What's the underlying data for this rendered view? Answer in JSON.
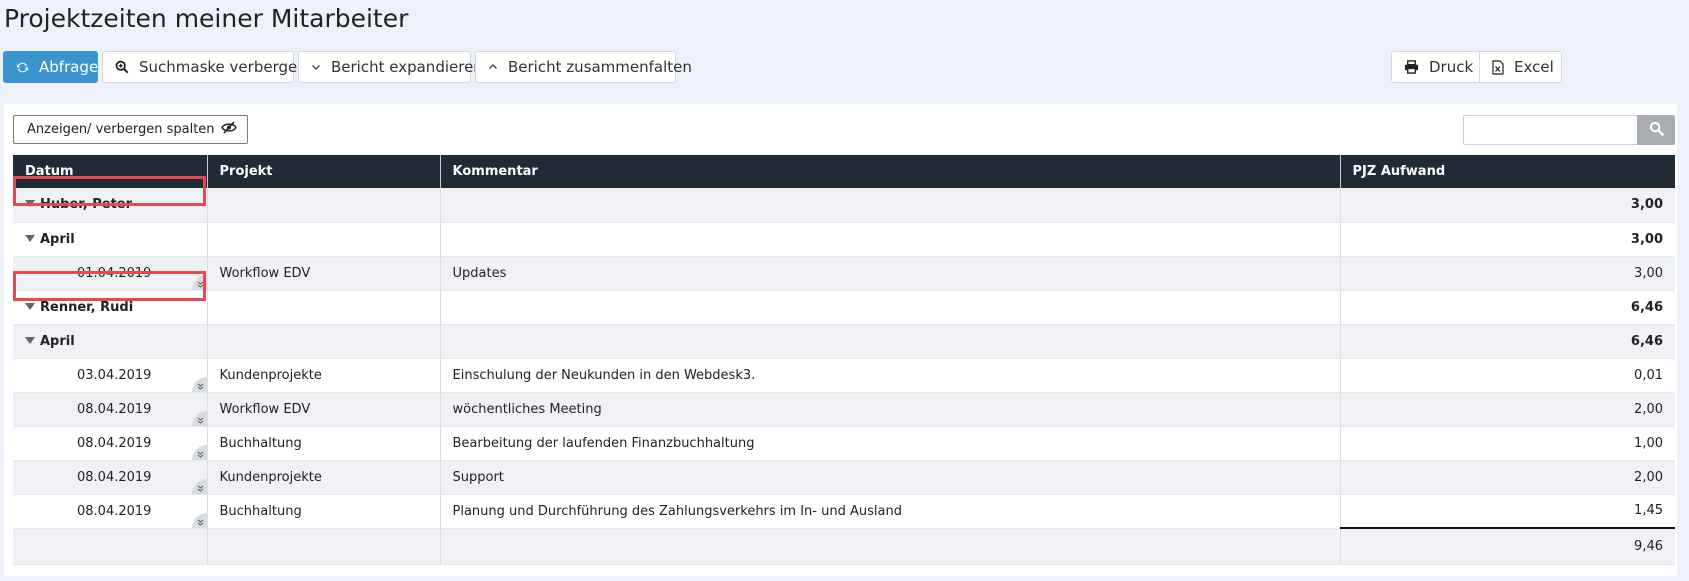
{
  "page": {
    "title": "Projektzeiten meiner Mitarbeiter"
  },
  "toolbar": {
    "query_label": "Abfrage",
    "hide_search_label": "Suchmaske verbergen",
    "expand_label": "Bericht expandieren",
    "collapse_label": "Bericht zusammenfalten",
    "print_label": "Druck",
    "excel_label": "Excel"
  },
  "panel": {
    "columns_toggle_label": "Anzeigen/ verbergen spalten",
    "search_placeholder": ""
  },
  "table": {
    "headers": [
      "Datum",
      "Projekt",
      "Kommentar",
      "PJZ Aufwand"
    ],
    "groups": [
      {
        "employee": "Huber, Peter",
        "total": "3,00",
        "months": [
          {
            "month": "April",
            "total": "3,00",
            "rows": [
              {
                "date": "01.04.2019",
                "project": "Workflow EDV",
                "comment": "Updates",
                "effort": "3,00"
              }
            ]
          }
        ]
      },
      {
        "employee": "Renner, Rudi",
        "total": "6,46",
        "months": [
          {
            "month": "April",
            "total": "6,46",
            "rows": [
              {
                "date": "03.04.2019",
                "project": "Kundenprojekte",
                "comment": "Einschulung der Neukunden in den Webdesk3.",
                "effort": "0,01"
              },
              {
                "date": "08.04.2019",
                "project": "Workflow EDV",
                "comment": "wöchentliches Meeting",
                "effort": "2,00"
              },
              {
                "date": "08.04.2019",
                "project": "Buchhaltung",
                "comment": "Bearbeitung der laufenden Finanzbuchhaltung",
                "effort": "1,00"
              },
              {
                "date": "08.04.2019",
                "project": "Kundenprojekte",
                "comment": "Support",
                "effort": "2,00"
              },
              {
                "date": "08.04.2019",
                "project": "Buchhaltung",
                "comment": "Planung und Durchführung des Zahlungsverkehrs im In- und Ausland",
                "effort": "1,45"
              }
            ]
          }
        ]
      }
    ],
    "grand_total": "9,46"
  },
  "colors": {
    "primary": "#3c94cf",
    "header_bg": "#212b38",
    "highlight": "#e64a4f",
    "alt_row": "#eff1f5"
  },
  "icons": [
    "refresh-icon",
    "zoom-icon",
    "chevron-down-icon",
    "chevron-up-icon",
    "printer-icon",
    "excel-file-icon",
    "eye-slash-icon",
    "search-icon",
    "expand-row-icon",
    "caret-down-icon"
  ]
}
